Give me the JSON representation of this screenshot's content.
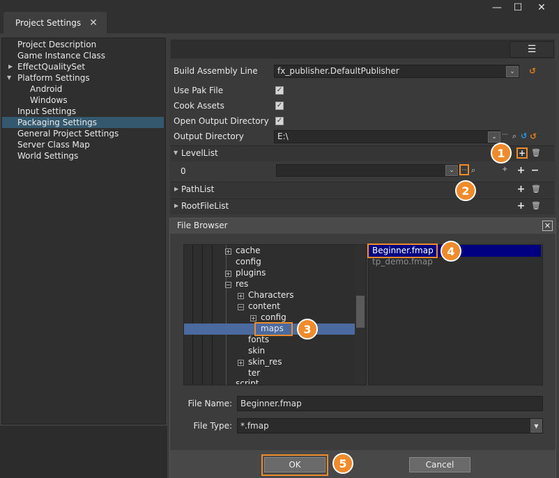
{
  "window": {
    "minimize": "—",
    "maximize": "☐",
    "close": "✕"
  },
  "tab": {
    "title": "Project Settings",
    "close": "✕"
  },
  "sidebar": {
    "items": [
      {
        "label": "Project Description"
      },
      {
        "label": "Game Instance Class"
      },
      {
        "label": "EffectQualitySet"
      },
      {
        "label": "Platform Settings"
      },
      {
        "label": "Android"
      },
      {
        "label": "Windows"
      },
      {
        "label": "Input Settings"
      },
      {
        "label": "Packaging Settings"
      },
      {
        "label": "General Project Settings"
      },
      {
        "label": "Server Class Map"
      },
      {
        "label": "World Settings"
      }
    ]
  },
  "properties": {
    "build_assembly_line": {
      "label": "Build Assembly Line",
      "value": "fx_publisher.DefaultPublisher"
    },
    "use_pak_file": {
      "label": "Use Pak File",
      "checked": "✓"
    },
    "cook_assets": {
      "label": "Cook Assets",
      "checked": "✓"
    },
    "open_output_directory": {
      "label": "Open Output Directory",
      "checked": "✓"
    },
    "output_directory": {
      "label": "Output Directory",
      "value": "E:\\"
    }
  },
  "sections": {
    "level_list": {
      "title": "LevelList",
      "index": "0"
    },
    "path_list": {
      "title": "PathList"
    },
    "root_file_list": {
      "title": "RootFileList"
    }
  },
  "icons": {
    "dots": "···",
    "search": "⌕",
    "reset": "↺",
    "plus": "+",
    "minus": "−",
    "trash": "🗑",
    "menu": "☰",
    "expand": "▶",
    "collapse": "▼",
    "combo": "⌄"
  },
  "badges": [
    "1",
    "2",
    "3",
    "4",
    "5"
  ],
  "file_browser": {
    "title": "File Browser",
    "tree": [
      {
        "label": "cache"
      },
      {
        "label": "config"
      },
      {
        "label": "plugins"
      },
      {
        "label": "res"
      },
      {
        "label": "Characters"
      },
      {
        "label": "content"
      },
      {
        "label": "config"
      },
      {
        "label": "maps"
      },
      {
        "label": "fonts"
      },
      {
        "label": "skin"
      },
      {
        "label": "skin_res"
      },
      {
        "label": "ter"
      },
      {
        "label": "script"
      }
    ],
    "files": [
      {
        "label": "Beginner.fmap"
      },
      {
        "label": "tp_demo.fmap"
      }
    ],
    "file_name_label": "File Name:",
    "file_name_value": "Beginner.fmap",
    "file_type_label": "File Type:",
    "file_type_value": "*.fmap",
    "ok": "OK",
    "cancel": "Cancel"
  },
  "colors": {
    "accent": "#f08b2b",
    "selection": "#34596f",
    "file_selection": "#000080"
  }
}
